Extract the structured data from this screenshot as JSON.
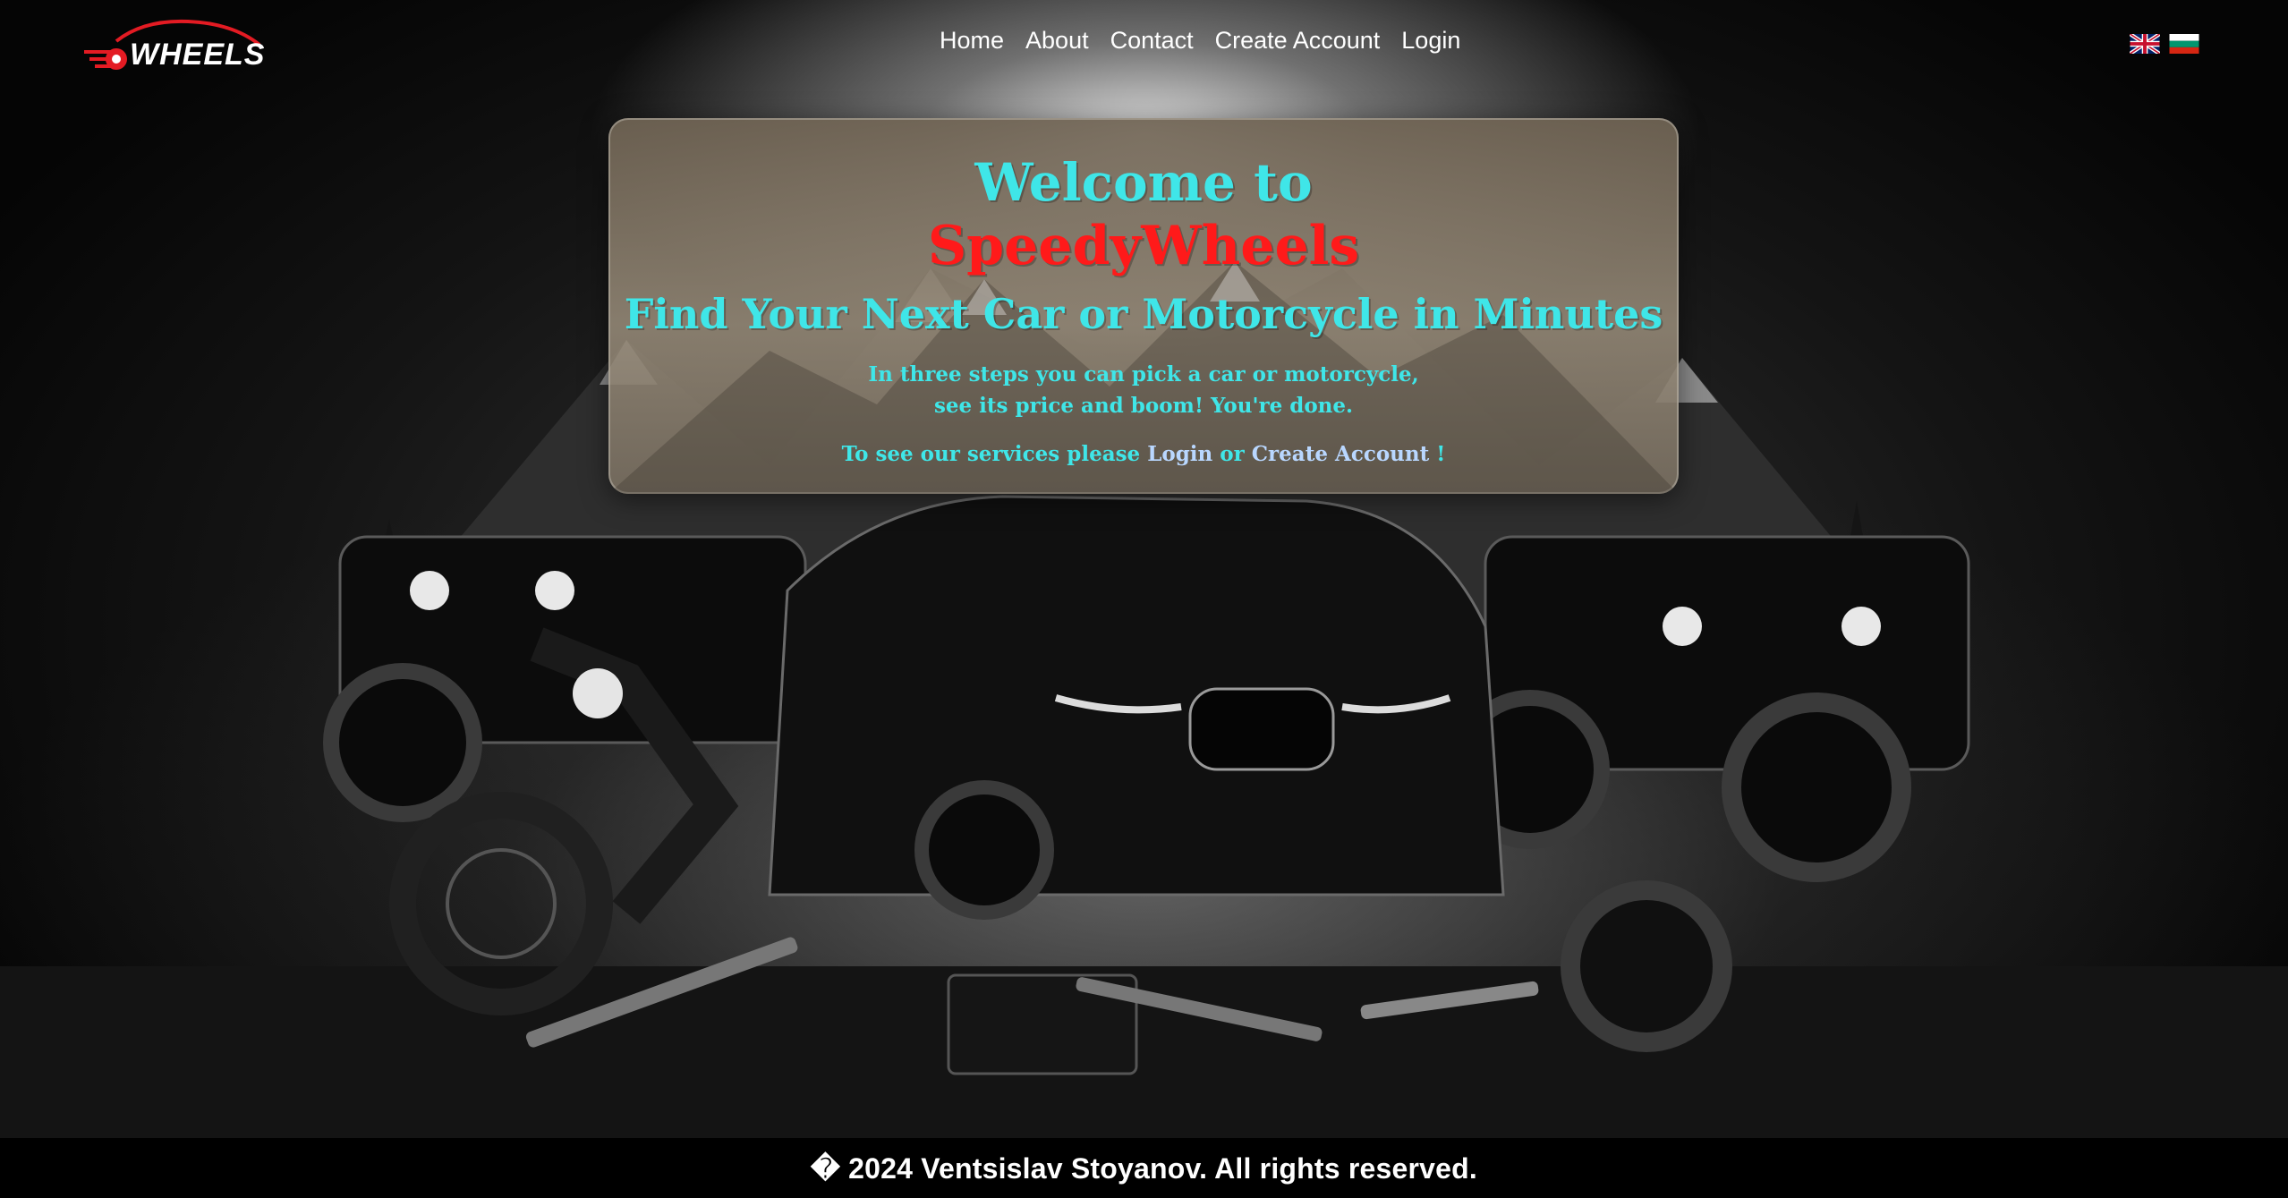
{
  "brand": {
    "logo_text": "WHEELS"
  },
  "nav": {
    "links": [
      {
        "label": "Home"
      },
      {
        "label": "About"
      },
      {
        "label": "Contact"
      },
      {
        "label": "Create Account"
      },
      {
        "label": "Login"
      }
    ],
    "languages": [
      "uk-flag-icon",
      "bulgaria-flag-icon"
    ]
  },
  "hero": {
    "line1": "Welcome to",
    "line2": "SpeedyWheels",
    "line3": "Find Your Next Car or Motorcycle in Minutes",
    "paragraph_line1": "In three steps you can pick a car or motorcycle,",
    "paragraph_line2": "see its price and boom! You're done.",
    "cta_prefix": "To see our services please ",
    "cta_login": "Login",
    "cta_or": " or ",
    "cta_create": "Create Account",
    "cta_suffix": " !"
  },
  "footer": {
    "text": "� 2024 Ventsislav Stoyanov. All rights reserved."
  },
  "colors": {
    "accent_cyan": "#3fe6e8",
    "brand_red": "#ff1a1a",
    "link_blue": "#b9d7ff",
    "background": "#000000"
  }
}
